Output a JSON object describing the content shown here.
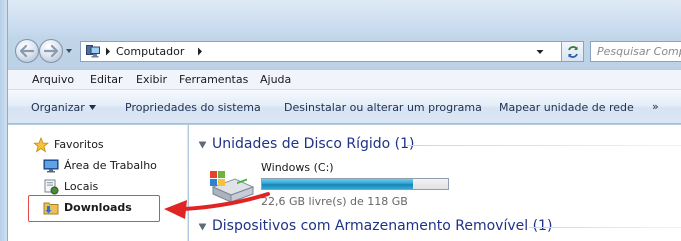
{
  "colors": {
    "group_header": "#1e3287",
    "accent_fill": "#2fa4d3",
    "annotation": "#e02424"
  },
  "address": {
    "crumb": "Computador",
    "search_placeholder": "Pesquisar Comp"
  },
  "menu": {
    "items": [
      "Arquivo",
      "Editar",
      "Exibir",
      "Ferramentas",
      "Ajuda"
    ]
  },
  "commands": {
    "organize": "Organizar",
    "properties": "Propriedades do sistema",
    "uninstall": "Desinstalar ou alterar um programa",
    "map_drive": "Mapear unidade de rede",
    "more": "»"
  },
  "nav_pane": {
    "favorites": "Favoritos",
    "desktop": "Área de Trabalho",
    "locals": "Locais",
    "downloads": "Downloads"
  },
  "content": {
    "group_hdd": "Unidades de Disco Rígido (1)",
    "group_removable": "Dispositivos com Armazenamento Removível (1)",
    "drive": {
      "name": "Windows (C:)",
      "free_text": "22,6 GB livre(s) de 118 GB",
      "used_fraction": 0.81
    }
  },
  "icons": {
    "back": "back-arrow-icon",
    "forward": "forward-arrow-icon",
    "computer": "computer-icon",
    "refresh": "refresh-icon",
    "favorites": "star-icon",
    "desktop": "desktop-icon",
    "locals": "recent-places-icon",
    "downloads": "downloads-folder-icon",
    "drive": "hard-drive-icon"
  }
}
